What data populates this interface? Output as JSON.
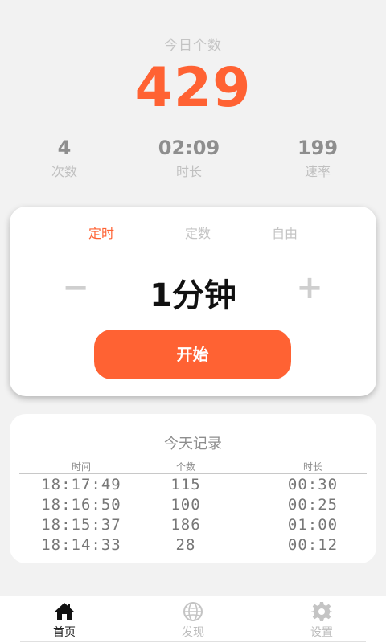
{
  "header": {
    "today_label": "今日个数",
    "today_count": "429",
    "metrics": [
      {
        "value": "4",
        "label": "次数"
      },
      {
        "value": "02:09",
        "label": "时长"
      },
      {
        "value": "199",
        "label": "速率"
      }
    ]
  },
  "timer": {
    "tabs": [
      {
        "label": "定时",
        "active": true
      },
      {
        "label": "定数",
        "active": false
      },
      {
        "label": "自由",
        "active": false
      }
    ],
    "minus_label": "−",
    "plus_label": "+",
    "duration": "1分钟",
    "start_label": "开始"
  },
  "records": {
    "title": "今天记录",
    "columns": [
      "时间",
      "个数",
      "时长"
    ],
    "rows": [
      [
        "18:17:49",
        "115",
        "00:30"
      ],
      [
        "18:16:50",
        "100",
        "00:25"
      ],
      [
        "18:15:37",
        "186",
        "01:00"
      ],
      [
        "18:14:33",
        "28",
        "00:12"
      ]
    ]
  },
  "nav": {
    "items": [
      {
        "label": "首页",
        "icon": "home-icon",
        "active": true
      },
      {
        "label": "发现",
        "icon": "globe-icon",
        "active": false
      },
      {
        "label": "设置",
        "icon": "gear-icon",
        "active": false
      }
    ]
  },
  "colors": {
    "accent": "#ff6233",
    "background": "#f2f2f2"
  }
}
